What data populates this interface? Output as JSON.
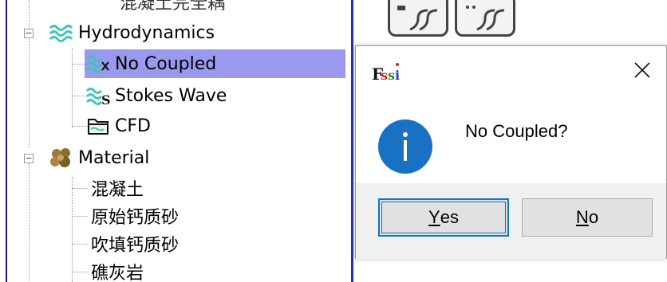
{
  "tree": {
    "clipped_item": "混凝土完全耦",
    "hydro_label": "Hydrodynamics",
    "no_coupled_label": "No Coupled",
    "stokes_label": "Stokes Wave",
    "cfd_label": "CFD",
    "material_label": "Material",
    "materials": [
      "混凝土",
      "原始钙质砂",
      "吹填钙质砂",
      "礁灰岩"
    ],
    "expander_symbol": "−"
  },
  "dialog": {
    "app_logo": "Fssi",
    "message": "No Coupled?",
    "close_symbol": "✕",
    "yes": {
      "mnemonic": "Y",
      "rest": "es"
    },
    "no": {
      "mnemonic": "N",
      "rest": "o"
    }
  },
  "colors": {
    "selection": "#9999ee",
    "accent_blue": "#0078d7",
    "info_icon": "#1971c4",
    "wave_icon": "#3cc6b4",
    "panel_border": "#2d2dbb"
  },
  "icons": [
    "hydrodynamics-wave-icon",
    "no-coupled-wave-icon",
    "stokes-wave-icon",
    "cfd-folder-icon",
    "material-icon",
    "info-icon",
    "close-icon",
    "app-logo"
  ]
}
